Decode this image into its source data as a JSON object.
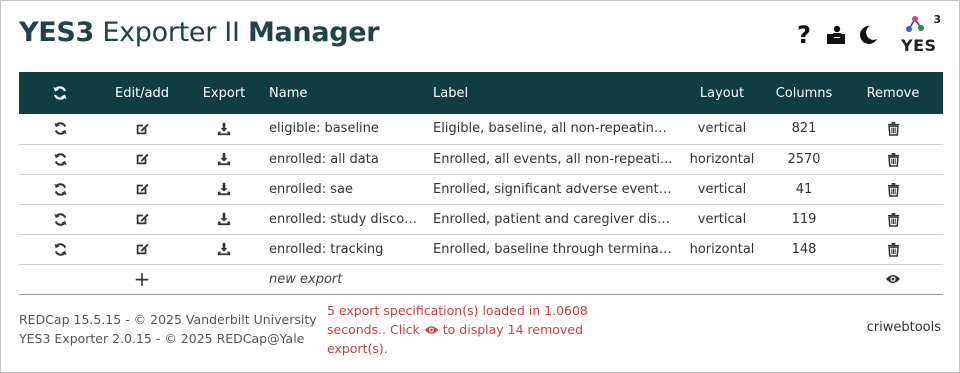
{
  "header": {
    "title_part1": "YES3",
    "title_part2": "Exporter II",
    "title_part3": "Manager",
    "help_label": "?",
    "logo_text": "YES",
    "logo_superscript": "3"
  },
  "table": {
    "headers": {
      "refresh_icon": "refresh-icon",
      "edit": "Edit/add",
      "export": "Export",
      "name": "Name",
      "label": "Label",
      "layout": "Layout",
      "columns": "Columns",
      "remove": "Remove"
    },
    "rows": [
      {
        "name": "eligible: baseline",
        "label": "Eligible, baseline, all non-repeating ...",
        "layout": "vertical",
        "columns": "821"
      },
      {
        "name": "enrolled: all data",
        "label": "Enrolled, all events, all non-repeati...",
        "layout": "horizontal",
        "columns": "2570"
      },
      {
        "name": "enrolled: sae",
        "label": "Enrolled, significant adverse events ...",
        "layout": "vertical",
        "columns": "41"
      },
      {
        "name": "enrolled: study discont...",
        "label": "Enrolled, patient and caregiver disc...",
        "layout": "vertical",
        "columns": "119"
      },
      {
        "name": "enrolled: tracking",
        "label": "Enrolled, baseline through terminat...",
        "layout": "horizontal",
        "columns": "148"
      }
    ],
    "new_row": {
      "plus": "+",
      "name_placeholder": "new export"
    }
  },
  "footer": {
    "line1": "REDCap 15.5.15 - © 2025 Vanderbilt University",
    "line2": "YES3 Exporter 2.0.15 - © 2025 REDCap@Yale",
    "message_before": "5 export specification(s) loaded in 1.0608 seconds.. Click",
    "message_after": "to display 14 removed export(s).",
    "right_link": "criwebtools"
  },
  "colors": {
    "header_bg": "#0f3d42",
    "title": "#1e4447",
    "message": "#c94040"
  }
}
